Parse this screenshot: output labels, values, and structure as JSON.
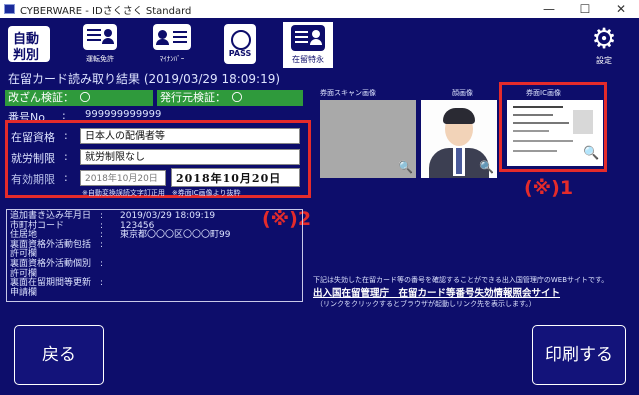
{
  "window": {
    "title": "CYBERWARE - IDさくさく Standard",
    "minimize": "—",
    "maximize": "☐",
    "close": "✕"
  },
  "toolbar": {
    "auto_label_1": "自動",
    "auto_label_2": "判別",
    "license_label": "運転免許",
    "mynumber_label": "ﾏｲﾅﾝﾊﾞｰ",
    "passport_label": "PASS",
    "residence_label": "在留特永",
    "settings_label": "設定"
  },
  "result": {
    "title": "在留カード読み取り結果 (2019/03/29 18:09:19)",
    "tamper_check": "改ざん検証：　〇",
    "issuer_check": "発行元検証：　〇",
    "number_label": "番号No",
    "number_colon": ":",
    "number_value": "999999999999"
  },
  "fields": {
    "status_label": "在留資格",
    "status_value": "日本人の配偶者等",
    "work_label": "就労制限",
    "work_value": "就労制限なし",
    "expiry_label": "有効期限",
    "expiry_value": "2018年10月20日",
    "expiry_big": "2018年10月20日",
    "note": "※自動変換誤読文字訂正用　※券面IC画像より抜粋",
    "colon": ":"
  },
  "images": {
    "scan_label": "券面スキャン画像",
    "face_label": "顔画像",
    "ic_label": "券面IC画像"
  },
  "annotations": {
    "mark1": "(※)1",
    "mark2": "(※)2"
  },
  "extra": {
    "rows": [
      {
        "label": "追加書き込み年月日",
        "value": "2019/03/29 18:09:19"
      },
      {
        "label": "市町村コード",
        "value": "123456"
      },
      {
        "label": "住居地",
        "value": "東京都〇〇〇区〇〇〇町99"
      },
      {
        "label": "裏面資格外活動包括",
        "value": ""
      },
      {
        "label": "許可欄",
        "value": ""
      },
      {
        "label": "裏面資格外活動個別",
        "value": ""
      },
      {
        "label": "許可欄",
        "value": ""
      },
      {
        "label": "裏面在留期間等更新",
        "value": ""
      },
      {
        "label": "申請欄",
        "value": ""
      }
    ],
    "colon": ":"
  },
  "info": {
    "desc": "下記は失効した在留カード等の番号を確認することができる出入国管理庁のWEBサイトです。",
    "link": "出入国在留管理庁　在留カード等番号失効情報照会サイト",
    "hint": "（リンクをクリックするとブラウザが起動しリンク先を表示します。）"
  },
  "buttons": {
    "back": "戻る",
    "print": "印刷する"
  },
  "colors": {
    "background": "#0d0d6b",
    "green": "#2f9a3c",
    "red_annotation": "#e42b2b"
  }
}
